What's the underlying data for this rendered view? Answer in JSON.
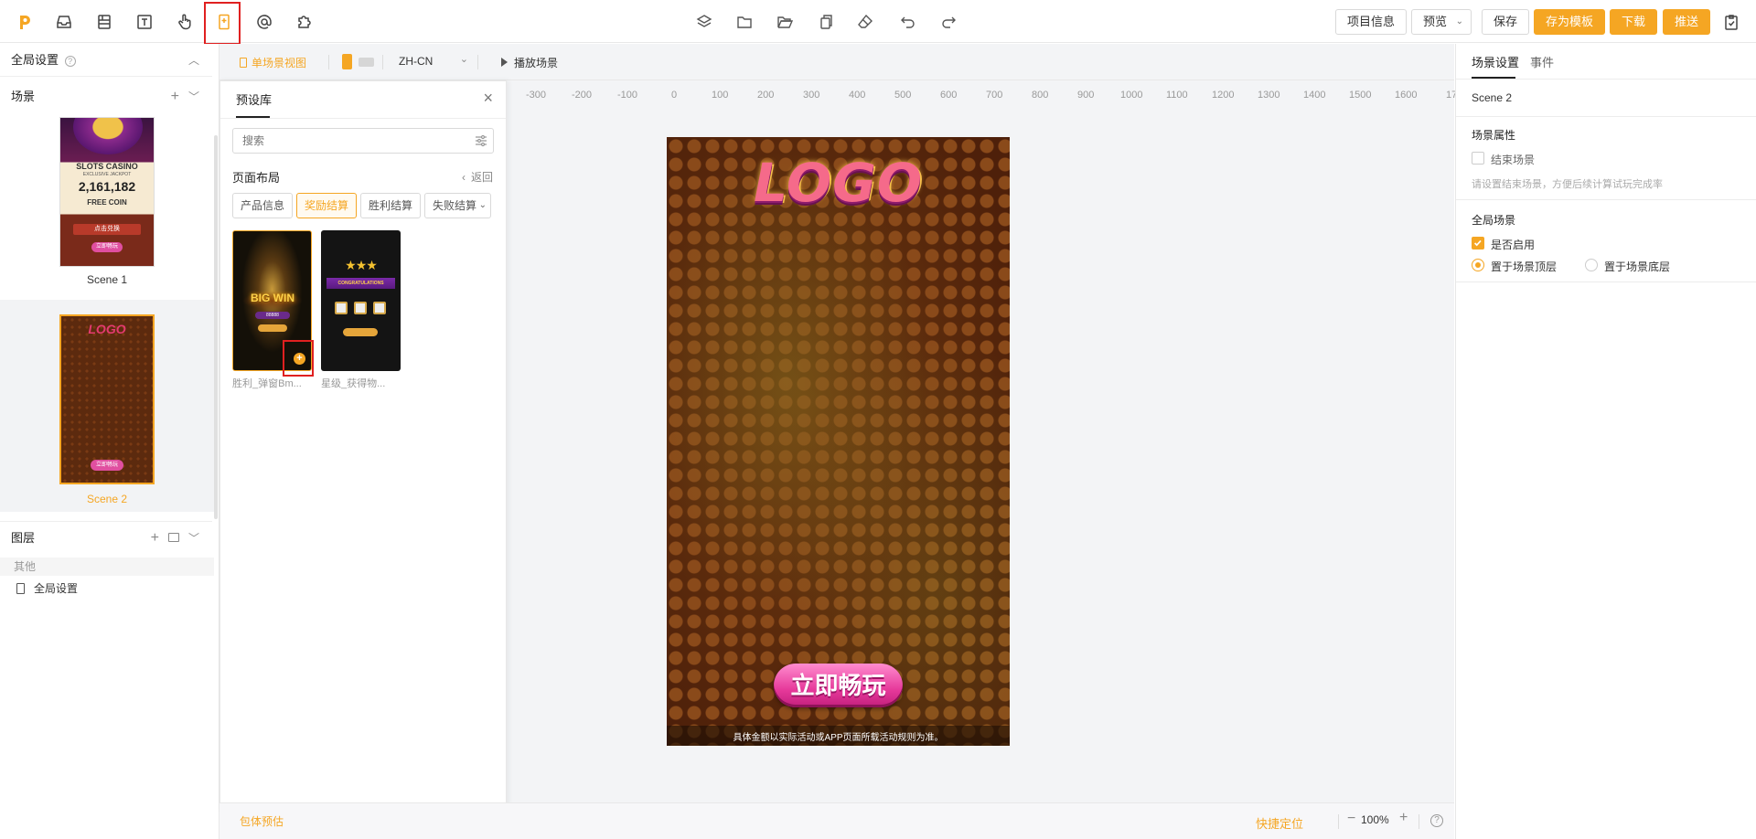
{
  "toolbar": {
    "right_buttons": {
      "project_info": "项目信息",
      "preview": "预览",
      "save": "保存",
      "save_as_template": "存为模板",
      "download": "下载",
      "push": "推送"
    }
  },
  "left_panel": {
    "global_settings": "全局设置",
    "scenes_title": "场景",
    "scenes": [
      {
        "name": "Scene 1",
        "thumb": {
          "title": "SLOTS CASINO",
          "subtitle": "EXCLUSIVE JACKPOT",
          "amount": "2,161,182",
          "free": "FREE COIN",
          "button": "点击兑换",
          "cta": "立即畅玩"
        }
      },
      {
        "name": "Scene 2",
        "thumb": {
          "logo": "LOGO",
          "cta": "立即畅玩"
        }
      }
    ],
    "layers_title": "图层",
    "layers_group": "其他",
    "layers_items": [
      "全局设置"
    ],
    "bottom_link": "包体预估"
  },
  "canvas_bar": {
    "view_mode": "单场景视图",
    "language": "ZH-CN",
    "play_scene": "播放场景"
  },
  "preset_panel": {
    "tab": "预设库",
    "search_placeholder": "搜索",
    "section": "页面布局",
    "back": "返回",
    "chips": [
      "产品信息",
      "奖励结算",
      "胜利结算",
      "失败结算"
    ],
    "active_chip": "奖励结算",
    "cards": [
      {
        "label": "胜利_弹窗Bm...",
        "art_text": "BIG WIN",
        "art_amount": "88888"
      },
      {
        "label": "星级_获得物...",
        "art_text": "CONGRATULATIONS"
      }
    ]
  },
  "ruler": {
    "ticks": [
      "-300",
      "-200",
      "-100",
      "0",
      "100",
      "200",
      "300",
      "400",
      "500",
      "600",
      "700",
      "800",
      "900",
      "1000",
      "1100",
      "1200",
      "1300",
      "1400",
      "1500",
      "1600",
      "17"
    ]
  },
  "phone": {
    "logo": "LOGO",
    "cta": "立即畅玩",
    "disclaimer": "具体金额以实际活动或APP页面所载活动规则为准。"
  },
  "bottom_bar": {
    "quick_locate": "快捷定位",
    "zoom": "100%"
  },
  "right_panel": {
    "tabs": [
      "场景设置",
      "事件"
    ],
    "scene_name": "Scene 2",
    "scene_props_title": "场景属性",
    "end_scene_label": "结束场景",
    "end_scene_checked": false,
    "end_scene_hint": "请设置结束场景，方便后续计算试玩完成率",
    "global_scene_title": "全局场景",
    "enable_label": "是否启用",
    "enable_checked": true,
    "radio_top": "置于场景顶层",
    "radio_bottom": "置于场景底层",
    "radio_selected": "置于场景顶层"
  },
  "colors": {
    "accent": "#f5a623",
    "highlight_box": "#e02020",
    "canvas_bg": "#f3f4f6",
    "phone_bg": "#5c2a0e"
  }
}
